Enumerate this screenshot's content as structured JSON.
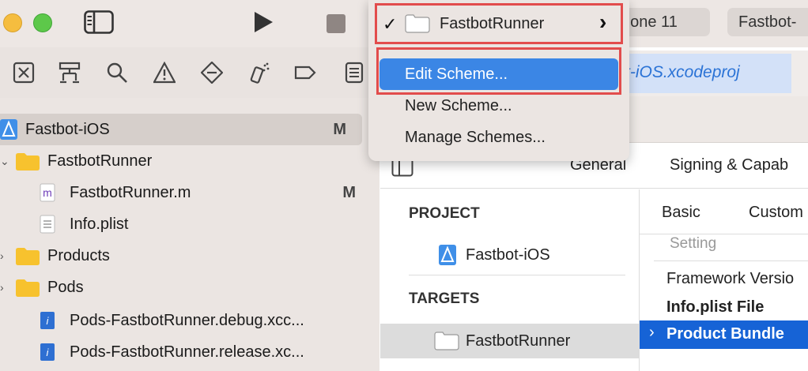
{
  "toolbar": {
    "device_label": "iPhone 11",
    "device_visible": "hone 11",
    "project_label": "Fastbot-",
    "icons": [
      "sidebar-toggle-icon",
      "run-icon",
      "stop-icon"
    ]
  },
  "navigator_icons": [
    "project-navigator-icon",
    "source-control-icon",
    "find-icon",
    "issue-icon",
    "test-icon",
    "debug-icon",
    "breakpoint-icon",
    "report-icon"
  ],
  "sidebar": {
    "items": [
      {
        "label": "Fastbot-iOS",
        "badge": "M",
        "icon": "xcode-project-icon"
      },
      {
        "label": "FastbotRunner",
        "badge": "",
        "icon": "folder-icon"
      },
      {
        "label": "FastbotRunner.m",
        "badge": "M",
        "icon": "objc-file-icon"
      },
      {
        "label": "Info.plist",
        "badge": "",
        "icon": "plist-file-icon"
      },
      {
        "label": "Products",
        "badge": "",
        "icon": "folder-icon"
      },
      {
        "label": "Pods",
        "badge": "",
        "icon": "folder-icon"
      },
      {
        "label": "Pods-FastbotRunner.debug.xcc...",
        "badge": "",
        "icon": "xcconfig-file-icon"
      },
      {
        "label": "Pods-FastbotRunner.release.xc...",
        "badge": "",
        "icon": "xcconfig-file-icon"
      }
    ]
  },
  "pathbar": {
    "selected": "t-iOS.xcodeproj"
  },
  "editor_tabs": [
    "General",
    "Signing & Capab"
  ],
  "project_targets": {
    "project_header": "PROJECT",
    "project_item": "Fastbot-iOS",
    "targets_header": "TARGETS",
    "target_item": "FastbotRunner"
  },
  "build_settings": {
    "filter_basic": "Basic",
    "filter_custom": "Custom",
    "setting_header": "Setting",
    "rows": [
      "Framework Versio",
      "Info.plist File",
      "Product Bundle"
    ]
  },
  "scheme_menu": {
    "current_scheme": "FastbotRunner",
    "check": "✓",
    "chevron": "›",
    "items": [
      "Edit Scheme...",
      "New Scheme...",
      "Manage Schemes..."
    ]
  },
  "colors": {
    "highlight": "#3b86e5",
    "annotation": "#e24c4c",
    "selection": "#1663d6"
  }
}
